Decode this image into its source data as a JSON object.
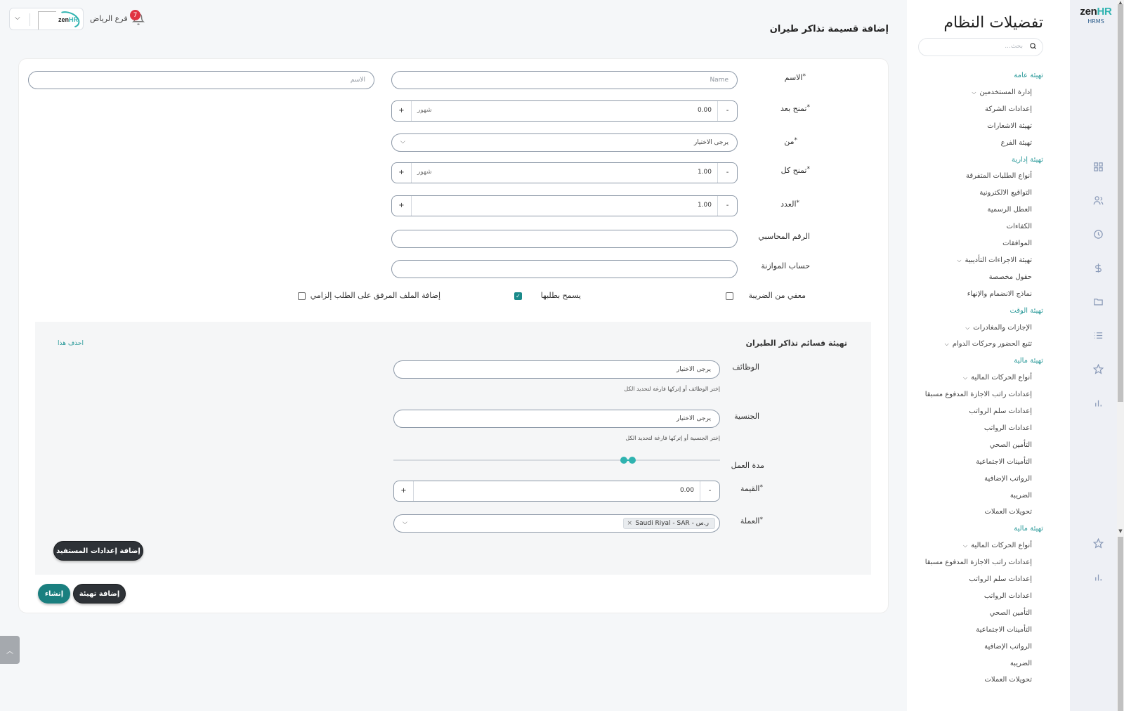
{
  "brand": {
    "logo_main": "zen",
    "logo_accent": "HR",
    "subtitle": "HRMS"
  },
  "panel": {
    "title": "تفضيلات النظام",
    "search_placeholder": "بحث..."
  },
  "nav": [
    {
      "label": "تهيئة عامة",
      "type": "section"
    },
    {
      "label": "إدارة المستخدمين",
      "type": "group"
    },
    {
      "label": "إعدادات الشركة",
      "type": "item"
    },
    {
      "label": "تهيئة الاشعارات",
      "type": "item"
    },
    {
      "label": "تهيئة الفرع",
      "type": "item"
    },
    {
      "label": "تهيئة إدارية",
      "type": "section"
    },
    {
      "label": "أنواع الطلبات المتفرقة",
      "type": "item"
    },
    {
      "label": "التواقيع الالكترونية",
      "type": "item"
    },
    {
      "label": "العطل الرسمية",
      "type": "item"
    },
    {
      "label": "الكفاءات",
      "type": "item"
    },
    {
      "label": "الموافقات",
      "type": "item"
    },
    {
      "label": "تهيئة الاجراءات التأديبية",
      "type": "group"
    },
    {
      "label": "حقول مخصصة",
      "type": "item"
    },
    {
      "label": "نماذج الانضمام والإنهاء",
      "type": "item"
    },
    {
      "label": "تهيئة الوقت",
      "type": "section"
    },
    {
      "label": "الإجازات والمغادرات",
      "type": "group"
    },
    {
      "label": "تتبع الحضور وحركات الدوام",
      "type": "group"
    },
    {
      "label": "تهيئة مالية",
      "type": "section"
    },
    {
      "label": "أنواع الحركات المالية",
      "type": "group"
    },
    {
      "label": "إعدادات راتب الاجازة المدفوع مسبقا",
      "type": "item"
    },
    {
      "label": "إعدادات سلم الرواتب",
      "type": "item"
    },
    {
      "label": "اعدادات الرواتب",
      "type": "item"
    },
    {
      "label": "التأمين الصحي",
      "type": "item"
    },
    {
      "label": "التأمينات الاجتماعية",
      "type": "item"
    },
    {
      "label": "الرواتب الإضافية",
      "type": "item"
    },
    {
      "label": "الضريبة",
      "type": "item"
    },
    {
      "label": "تحويلات العملات",
      "type": "item"
    },
    {
      "label": "تهيئة مالية",
      "type": "section"
    },
    {
      "label": "أنواع الحركات المالية",
      "type": "group"
    },
    {
      "label": "إعدادات راتب الاجازة المدفوع مسبقا",
      "type": "item"
    },
    {
      "label": "إعدادات سلم الرواتب",
      "type": "item"
    },
    {
      "label": "اعدادات الرواتب",
      "type": "item"
    },
    {
      "label": "التأمين الصحي",
      "type": "item"
    },
    {
      "label": "التأمينات الاجتماعية",
      "type": "item"
    },
    {
      "label": "الرواتب الإضافية",
      "type": "item"
    },
    {
      "label": "الضريبة",
      "type": "item"
    },
    {
      "label": "تحويلات العملات",
      "type": "item"
    }
  ],
  "header": {
    "page_title": "إضافة قسيمة تذاكر طيران",
    "branch": "فرع الرياض",
    "notification_count": "7",
    "mini_logo_main": "zen",
    "mini_logo_accent": "HR"
  },
  "form": {
    "name_label": "الاسم",
    "name_en_placeholder": "Name",
    "name_ar_placeholder": "الاسم",
    "grant_after_label": "تمنح بعد",
    "grant_after_value": "0.00",
    "grant_after_unit": "شهور",
    "from_label": "من",
    "from_placeholder": "يرجى الاختيار",
    "grant_every_label": "تمنح كل",
    "grant_every_value": "1.00",
    "grant_every_unit": "شهور",
    "count_label": "العدد",
    "count_value": "1.00",
    "accounting_label": "الرقم المحاسبي",
    "budget_label": "حساب الموازنة",
    "tax_exempt_label": "معفي من الضريبة",
    "tax_exempt_checked": false,
    "allow_request_label": "يسمح بطلبها",
    "allow_request_checked": true,
    "attachment_label": "إضافة الملف المرفق على الطلب إلزامي",
    "attachment_checked": false,
    "minus": "-",
    "plus": "+"
  },
  "config": {
    "title": "تهيئة قسائم تذاكر الطيران",
    "delete_label": "احذف هذا",
    "jobs_label": "الوظائف",
    "jobs_placeholder": "يرجى الاختيار",
    "jobs_hint": "إختر الوظائف أو إتركها فارغة لتحديد الكل",
    "nationality_label": "الجنسية",
    "nationality_placeholder": "يرجى الاختيار",
    "nationality_hint": "إختر الجنسية أو إتركها فارغة لتحديد الكل",
    "duration_label": "مدة العمل",
    "value_label": "القيمة",
    "value_value": "0.00",
    "currency_label": "العملة",
    "currency_tag": "Saudi Riyal - SAR - ر.س",
    "beneficiary_button": "إضافة إعدادات المستفيد"
  },
  "actions": {
    "add_config": "إضافة تهيئة",
    "create": "إنشاء"
  },
  "colors": {
    "accent": "#2fb3b0",
    "teal_button": "#1a7f7f",
    "dark_button": "#2e3237",
    "badge": "#e03442"
  }
}
